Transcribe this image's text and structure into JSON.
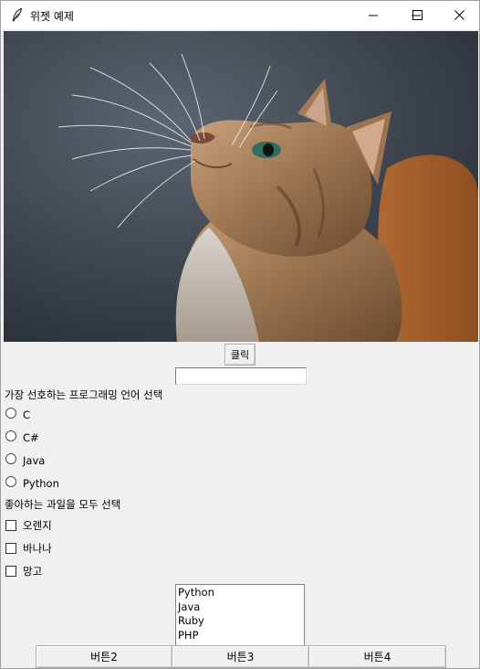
{
  "window": {
    "title": "위젯 예제",
    "minimize_icon": "minimize-icon",
    "maximize_icon": "maximize-icon",
    "close_icon": "close-icon"
  },
  "photo": {
    "subject": "cat-photo"
  },
  "click_button": {
    "label": "클릭"
  },
  "entry": {
    "value": ""
  },
  "language": {
    "label": "가장 선호하는 프로그래밍 언어 선택",
    "options": [
      "C",
      "C#",
      "Java",
      "Python"
    ]
  },
  "fruits": {
    "label": "좋아하는 과일을 모두 선택",
    "options": [
      "오렌지",
      "바나나",
      "망고"
    ]
  },
  "listbox": {
    "items": [
      "Python",
      "Java",
      "Ruby",
      "PHP"
    ]
  },
  "bottom_buttons": [
    "버튼2",
    "버튼3",
    "버튼4"
  ]
}
